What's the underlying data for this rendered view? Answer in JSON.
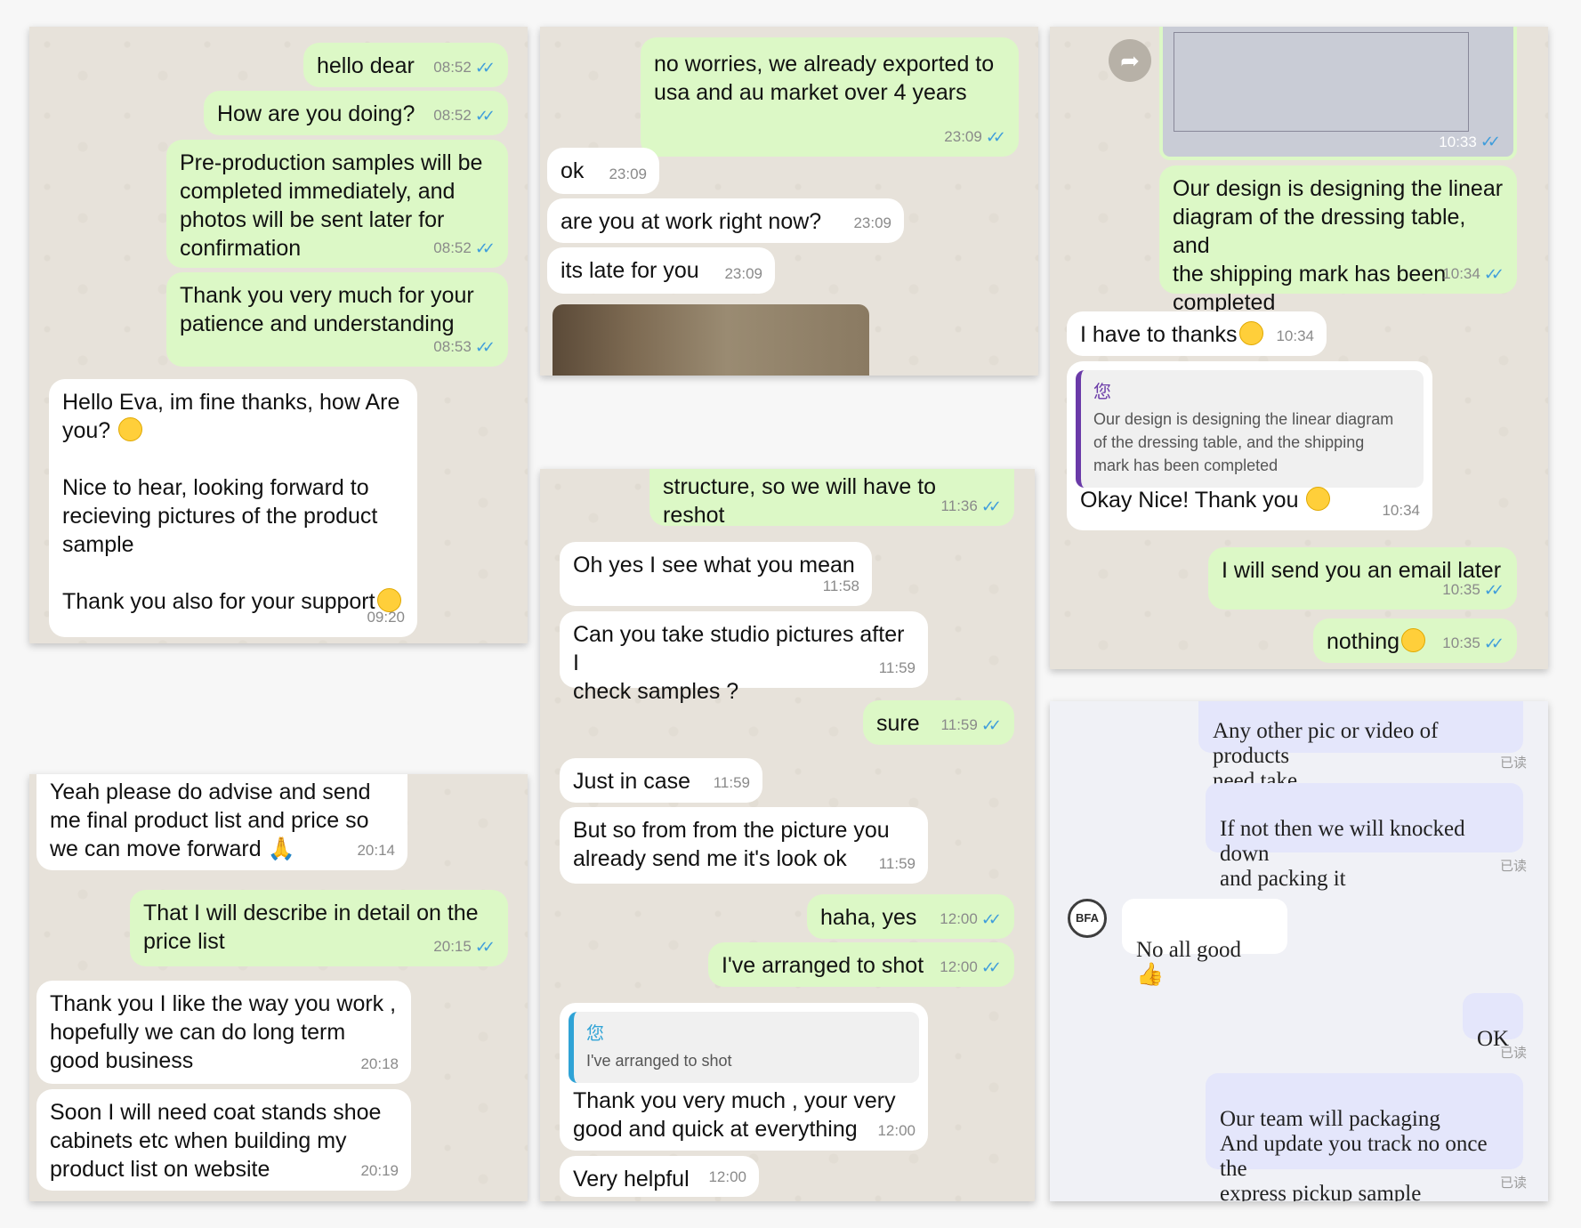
{
  "p1": {
    "m1": {
      "text": "hello dear",
      "time": "08:52"
    },
    "m2": {
      "text": "How are you doing?",
      "time": "08:52"
    },
    "m3": {
      "text": "Pre-production samples will be\ncompleted immediately, and\nphotos will be sent later for\nconfirmation",
      "time": "08:52"
    },
    "m4": {
      "text": "Thank you very much for your\npatience and understanding",
      "time": "08:53"
    },
    "m5": {
      "text": "Hello Eva, im fine thanks, how Are\nyou?",
      "text2": "Nice to hear, looking forward to\nrecieving pictures of the product\nsample",
      "text3": "Thank you also for your support",
      "time": "09:20"
    }
  },
  "p2": {
    "m1": {
      "text": "no worries, we already exported to\nusa and au market over 4 years",
      "time": "23:09"
    },
    "m2": {
      "text": "ok",
      "time": "23:09"
    },
    "m3": {
      "text": "are you at work right now?",
      "time": "23:09"
    },
    "m4": {
      "text": "its late for you",
      "time": "23:09"
    }
  },
  "p3": {
    "img_time": "10:33",
    "m1": {
      "text": "Our design is designing the linear\ndiagram of the dressing table, and\nthe shipping mark has been\ncompleted",
      "time": "10:34"
    },
    "m2": {
      "text": "I have to thanks",
      "time": "10:34"
    },
    "m3": {
      "quote_name": "您",
      "quote_text": "Our design is designing the linear diagram\nof the dressing table, and the shipping\nmark has been completed",
      "text": "Okay Nice! Thank you",
      "time": "10:34"
    },
    "m4": {
      "text": "I will send you an email later",
      "time": "10:35"
    },
    "m5": {
      "text": "nothing",
      "time": "10:35"
    }
  },
  "p4": {
    "m1": {
      "text": "Yeah please do advise and send\nme final product list and price so\nwe can move forward",
      "time": "20:14"
    },
    "m2": {
      "text": "That I will describe in detail on the\nprice list",
      "time": "20:15"
    },
    "m3": {
      "text": "Thank you I like the way you work ,\nhopefully we can do long term\ngood business",
      "time": "20:18"
    },
    "m4": {
      "text": "Soon I will need coat stands shoe\ncabinets etc when building my\nproduct list on website",
      "time": "20:19"
    }
  },
  "p5": {
    "m0": {
      "text": "structure, so we will have to reshot",
      "time": "11:36"
    },
    "m1": {
      "text": "Oh yes I see what you mean",
      "time": "11:58"
    },
    "m2": {
      "text": "Can you take studio pictures after I\ncheck samples ?",
      "time": "11:59"
    },
    "m3": {
      "text": "sure",
      "time": "11:59"
    },
    "m4": {
      "text": "Just in case",
      "time": "11:59"
    },
    "m5": {
      "text": "But so from from the picture you\nalready send me it's look ok",
      "time": "11:59"
    },
    "m6": {
      "text": "haha,  yes",
      "time": "12:00"
    },
    "m7": {
      "text": "I've arranged to shot",
      "time": "12:00"
    },
    "m8": {
      "quote_name": "您",
      "quote_text": "I've arranged to shot",
      "text": "Thank you very much , your very\ngood and quick at everything",
      "time": "12:00"
    },
    "m9": {
      "text": "Very helpful",
      "time": "12:00"
    }
  },
  "p6": {
    "read_label": "已读",
    "m1": {
      "text": "Any other pic or video of products\nneed take"
    },
    "m2": {
      "text": "If not then we will knocked down\nand packing it"
    },
    "avatar": "BFA",
    "m3": {
      "text": "No all good"
    },
    "m4": {
      "text": "OK"
    },
    "m5": {
      "text": "Our team will packaging\nAnd update you track no once the\nexpress pickup sample"
    }
  },
  "icons": {
    "tick": "double-check-icon",
    "forward": "forward-arrow-icon",
    "emoji": "smiley-emoji-icon"
  }
}
